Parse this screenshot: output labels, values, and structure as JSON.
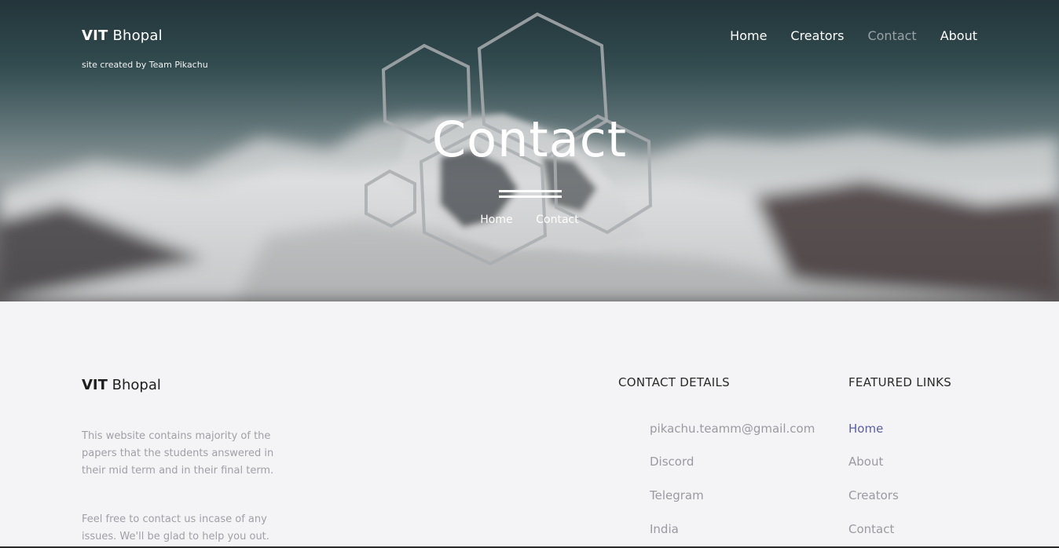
{
  "header": {
    "brand_bold": "VIT",
    "brand_light": "Bhopal",
    "subtitle": "site created by Team Pikachu",
    "nav": [
      {
        "label": "Home",
        "active": false
      },
      {
        "label": "Creators",
        "active": false
      },
      {
        "label": "Contact",
        "active": true
      },
      {
        "label": "About",
        "active": false
      }
    ]
  },
  "hero": {
    "title": "Contact",
    "breadcrumb": {
      "home": "Home",
      "separator": "/",
      "current": "Contact"
    }
  },
  "footer": {
    "brand_bold": "VIT",
    "brand_light": "Bhopal",
    "paragraph_1": "This website contains majority of the papers that the students answered in their mid term and in their final term.",
    "paragraph_2": "Feel free to contact us incase of any issues. We'll be glad to help you out.",
    "contact_heading": "CONTACT DETAILS",
    "contact_items": [
      "pikachu.teamm@gmail.com",
      "Discord",
      "Telegram",
      "India"
    ],
    "links_heading": "FEATURED LINKS",
    "links": [
      {
        "label": "Home",
        "active": true
      },
      {
        "label": "About",
        "active": false
      },
      {
        "label": "Creators",
        "active": false
      },
      {
        "label": "Contact",
        "active": false
      }
    ]
  },
  "colors": {
    "accent_link": "#5a5fa6",
    "nav_active": "#9aa2a6",
    "muted_text": "#9a9aa0"
  }
}
